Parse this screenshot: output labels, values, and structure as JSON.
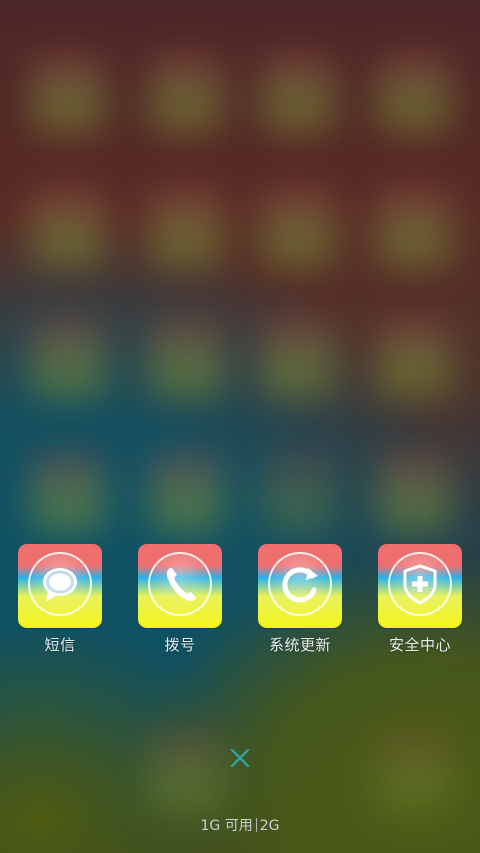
{
  "apps": [
    {
      "label": "短信",
      "icon": "message-bubble-icon"
    },
    {
      "label": "拨号",
      "icon": "phone-icon"
    },
    {
      "label": "系统更新",
      "icon": "refresh-icon"
    },
    {
      "label": "安全中心",
      "icon": "shield-plus-icon"
    }
  ],
  "close": {
    "icon": "close-icon"
  },
  "memory": {
    "available": "1G 可用",
    "total": "2G"
  },
  "colors": {
    "icon_top": "#ef6e6e",
    "icon_mid": "#2ab0e6",
    "icon_bottom": "#f4f41a",
    "close": "#2aa8a8",
    "label": "#e8ecef"
  }
}
